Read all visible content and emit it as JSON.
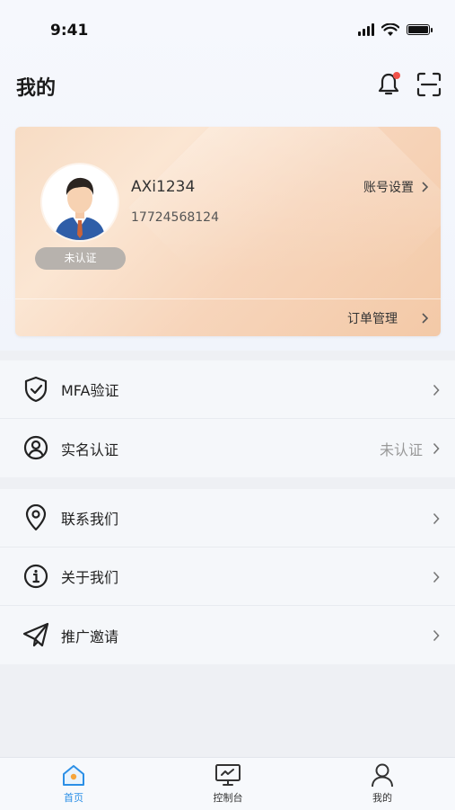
{
  "status_bar": {
    "time": "9:41"
  },
  "header": {
    "title": "我的"
  },
  "profile": {
    "username": "AXi1234",
    "phone": "17724568124",
    "verify_badge": "未认证",
    "account_settings_label": "账号设置",
    "order_management_label": "订单管理"
  },
  "menu": {
    "group1": [
      {
        "label": "MFA验证",
        "value": ""
      },
      {
        "label": "实名认证",
        "value": "未认证"
      }
    ],
    "group2": [
      {
        "label": "联系我们",
        "value": ""
      },
      {
        "label": "关于我们",
        "value": ""
      },
      {
        "label": "推广邀请",
        "value": ""
      }
    ]
  },
  "tabbar": [
    {
      "label": "首页",
      "icon": "home-icon",
      "active": true
    },
    {
      "label": "控制台",
      "icon": "console-icon",
      "active": false
    },
    {
      "label": "我的",
      "icon": "user-icon",
      "active": false
    }
  ],
  "colors": {
    "accent": "#2b8fe6",
    "badge_dot": "#f0524a",
    "card_gradient_start": "#f7dcc4",
    "card_gradient_end": "#f3c9a7"
  }
}
